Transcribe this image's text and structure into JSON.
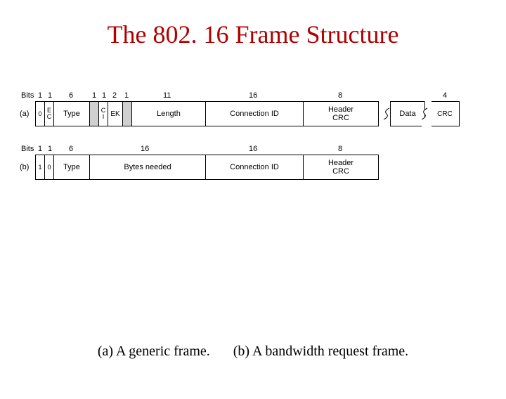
{
  "title": "The 802. 16 Frame Structure",
  "frame_a": {
    "row_label": "(a)",
    "bits_label": "Bits",
    "bits": [
      "1",
      "1",
      "6",
      "1",
      "1",
      "2",
      "1",
      "11",
      "16",
      "8",
      "4"
    ],
    "fields": {
      "f0": "0",
      "f1": "E\nC",
      "f2": "Type",
      "f3": "C\nI",
      "f4": "EK",
      "f5": "Length",
      "f6": "Connection ID",
      "f7": "Header\nCRC",
      "f8": "Data",
      "f9": "CRC"
    }
  },
  "frame_b": {
    "row_label": "(b)",
    "bits_label": "Bits",
    "bits": [
      "1",
      "1",
      "6",
      "16",
      "16",
      "8"
    ],
    "fields": {
      "f0": "1",
      "f1": "0",
      "f2": "Type",
      "f3": "Bytes needed",
      "f4": "Connection ID",
      "f5": "Header\nCRC"
    }
  },
  "captions": {
    "a": "(a) A generic frame.",
    "b": "(b) A bandwidth request frame."
  }
}
